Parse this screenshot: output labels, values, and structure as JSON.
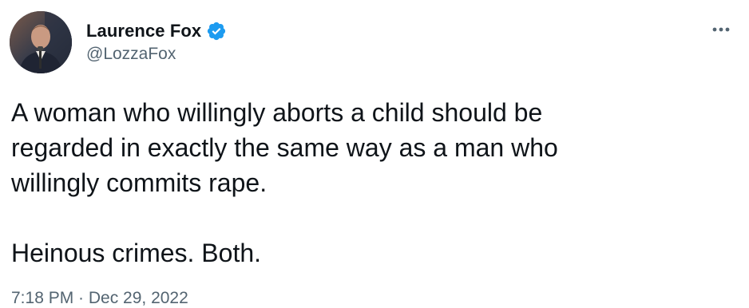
{
  "tweet": {
    "author": {
      "display_name": "Laurence Fox",
      "handle": "@LozzaFox",
      "verified": true
    },
    "text_lines": [
      "A woman who willingly aborts a child should be",
      "regarded in exactly the same way as a man who",
      "willingly commits rape."
    ],
    "text_line_2": "Heinous crimes. Both.",
    "timestamp": "7:18 PM · Dec 29, 2022"
  },
  "icons": {
    "verified": "verified-badge-icon",
    "more": "more-options-icon"
  },
  "colors": {
    "text_primary": "#0f1419",
    "text_secondary": "#536471",
    "verified_blue": "#1d9bf0",
    "background": "#ffffff"
  }
}
